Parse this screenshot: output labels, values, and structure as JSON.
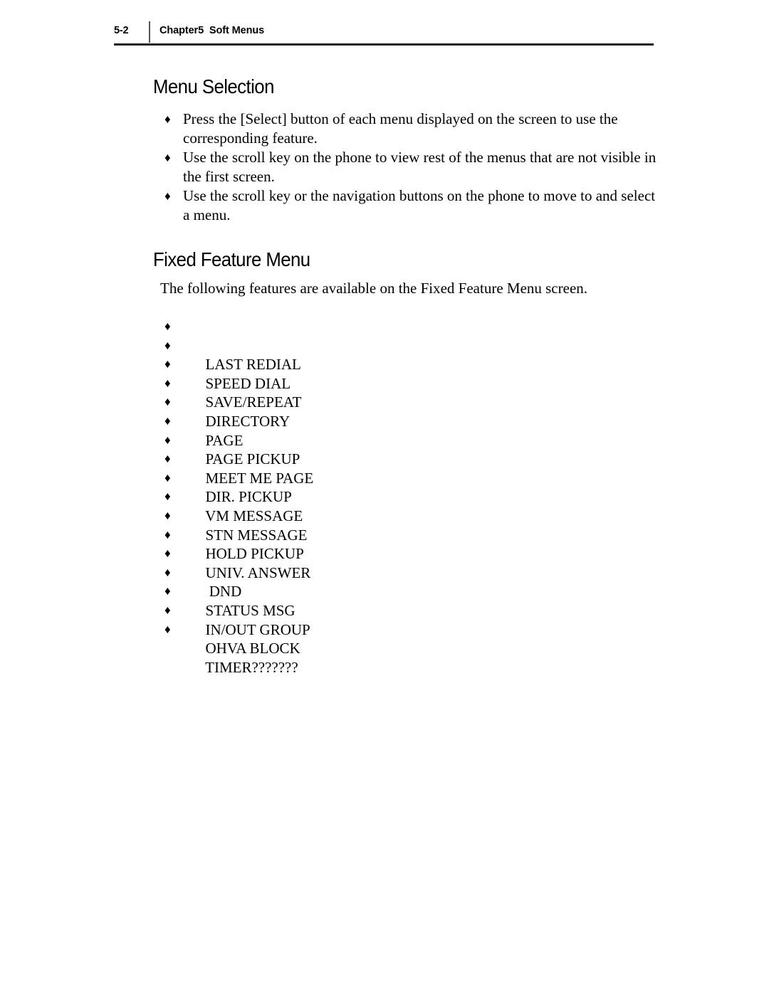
{
  "header": {
    "page_number": "5-2",
    "chapter_title": "Chapter5  Soft Menus"
  },
  "sections": [
    {
      "heading": "Menu Selection",
      "bullets": [
        "Press the [Select] button of each menu displayed on the screen to use the corresponding feature.",
        "Use the scroll key on the phone to view rest of the menus that are not visible in the first screen.",
        "Use the scroll key or the navigation buttons on the phone to move to and select a menu."
      ]
    },
    {
      "heading": "Fixed Feature Menu",
      "intro": "The following features are available on the Fixed Feature Menu screen.",
      "features": [
        "LAST REDIAL",
        "SPEED DIAL",
        "SAVE/REPEAT",
        "DIRECTORY",
        "PAGE",
        "PAGE PICKUP",
        "MEET ME PAGE",
        "DIR. PICKUP",
        "VM MESSAGE",
        "STN MESSAGE",
        "HOLD PICKUP",
        "UNIV. ANSWER",
        " DND",
        "STATUS MSG",
        "IN/OUT GROUP",
        "OHVA BLOCK",
        "TIMER???????"
      ]
    }
  ],
  "glyphs": {
    "bullet": "♦"
  }
}
